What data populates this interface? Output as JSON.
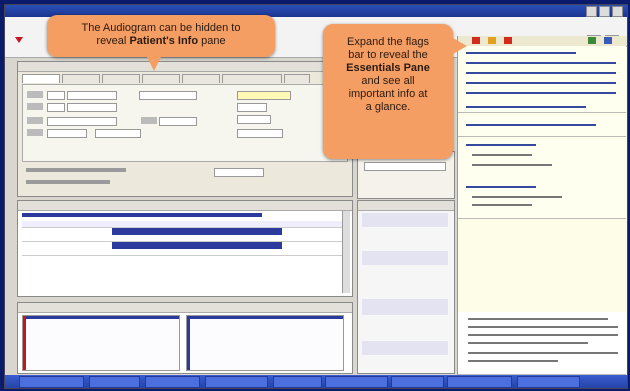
{
  "window": {
    "title": ""
  },
  "header": {
    "title": ""
  },
  "patient_panel": {
    "title": "",
    "tabs": [
      "",
      "",
      "",
      "",
      "",
      "",
      ""
    ]
  },
  "essentials_pane": {
    "sections": [
      {
        "heading": "",
        "lines": 6
      },
      {
        "heading": "",
        "lines": 2
      },
      {
        "heading": "",
        "lines": 4
      },
      {
        "heading": "",
        "lines": 6
      }
    ]
  },
  "callouts": {
    "audiogram": {
      "line1": "The Audiogram can be hidden to",
      "line2_prefix": "reveal ",
      "line2_bold": "Patient's Info",
      "line2_suffix": " pane"
    },
    "essentials": {
      "l1": "Expand the flags",
      "l2": "bar to reveal the",
      "l3_bold": "Essentials Pane",
      "l4": "and see all",
      "l5": "important info at",
      "l6": "a glance."
    }
  },
  "taskbar": {
    "buttons": [
      "",
      "",
      "",
      "",
      "",
      "",
      "",
      "",
      ""
    ]
  },
  "colors": {
    "desktop": "#0a1b6c",
    "callout": "#f59e63",
    "selection": "#2b3a9c",
    "essentials_bg": "#fefee8",
    "flag_red": "#d42a1c"
  }
}
